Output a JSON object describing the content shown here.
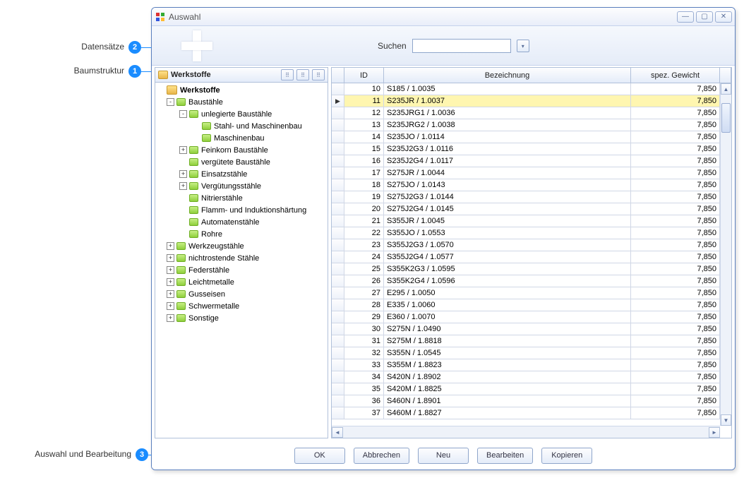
{
  "annotations": {
    "a1": {
      "label": "Baumstruktur",
      "num": "1"
    },
    "a2": {
      "label": "Datensätze",
      "num": "2"
    },
    "a3": {
      "label": "Auswahl und Bearbeitung",
      "num": "3"
    }
  },
  "window": {
    "title": "Auswahl"
  },
  "search": {
    "label": "Suchen",
    "value": ""
  },
  "tree": {
    "header": "Werkstoffe",
    "root": "Werkstoffe",
    "nodes": [
      {
        "indent": 1,
        "exp": "-",
        "icon": "green",
        "label": "Baustähle"
      },
      {
        "indent": 2,
        "exp": "-",
        "icon": "green",
        "label": "unlegierte Baustähle"
      },
      {
        "indent": 3,
        "exp": "",
        "icon": "green",
        "label": "Stahl- und Maschinenbau"
      },
      {
        "indent": 3,
        "exp": "",
        "icon": "green",
        "label": "Maschinenbau"
      },
      {
        "indent": 2,
        "exp": "+",
        "icon": "green",
        "label": "Feinkorn Baustähle"
      },
      {
        "indent": 2,
        "exp": "",
        "icon": "green",
        "label": "vergütete Baustähle"
      },
      {
        "indent": 2,
        "exp": "+",
        "icon": "green",
        "label": "Einsatzstähle"
      },
      {
        "indent": 2,
        "exp": "+",
        "icon": "green",
        "label": "Vergütungsstähle"
      },
      {
        "indent": 2,
        "exp": "",
        "icon": "green",
        "label": "Nitrierstähle"
      },
      {
        "indent": 2,
        "exp": "",
        "icon": "green",
        "label": "Flamm- und Induktionshärtung"
      },
      {
        "indent": 2,
        "exp": "",
        "icon": "green",
        "label": "Automatenstähle"
      },
      {
        "indent": 2,
        "exp": "",
        "icon": "green",
        "label": "Rohre"
      },
      {
        "indent": 1,
        "exp": "+",
        "icon": "green",
        "label": "Werkzeugstähle"
      },
      {
        "indent": 1,
        "exp": "+",
        "icon": "green",
        "label": "nichtrostende Stähle"
      },
      {
        "indent": 1,
        "exp": "+",
        "icon": "green",
        "label": "Federstähle"
      },
      {
        "indent": 1,
        "exp": "+",
        "icon": "green",
        "label": "Leichtmetalle"
      },
      {
        "indent": 1,
        "exp": "+",
        "icon": "green",
        "label": "Gusseisen"
      },
      {
        "indent": 1,
        "exp": "+",
        "icon": "green",
        "label": "Schwermetalle"
      },
      {
        "indent": 1,
        "exp": "+",
        "icon": "green",
        "label": "Sonstige"
      }
    ]
  },
  "table": {
    "columns": {
      "id": "ID",
      "bez": "Bezeichnung",
      "gew": "spez. Gewicht"
    },
    "selected_id": 11,
    "rows": [
      {
        "id": 10,
        "bez": "S185 / 1.0035",
        "gew": "7,850"
      },
      {
        "id": 11,
        "bez": "S235JR / 1.0037",
        "gew": "7,850"
      },
      {
        "id": 12,
        "bez": "S235JRG1 / 1.0036",
        "gew": "7,850"
      },
      {
        "id": 13,
        "bez": "S235JRG2 / 1.0038",
        "gew": "7,850"
      },
      {
        "id": 14,
        "bez": "S235JO / 1.0114",
        "gew": "7,850"
      },
      {
        "id": 15,
        "bez": "S235J2G3 / 1.0116",
        "gew": "7,850"
      },
      {
        "id": 16,
        "bez": "S235J2G4 / 1.0117",
        "gew": "7,850"
      },
      {
        "id": 17,
        "bez": "S275JR / 1.0044",
        "gew": "7,850"
      },
      {
        "id": 18,
        "bez": "S275JO / 1.0143",
        "gew": "7,850"
      },
      {
        "id": 19,
        "bez": "S275J2G3 / 1.0144",
        "gew": "7,850"
      },
      {
        "id": 20,
        "bez": "S275J2G4 / 1.0145",
        "gew": "7,850"
      },
      {
        "id": 21,
        "bez": "S355JR / 1.0045",
        "gew": "7,850"
      },
      {
        "id": 22,
        "bez": "S355JO / 1.0553",
        "gew": "7,850"
      },
      {
        "id": 23,
        "bez": "S355J2G3 / 1.0570",
        "gew": "7,850"
      },
      {
        "id": 24,
        "bez": "S355J2G4 / 1.0577",
        "gew": "7,850"
      },
      {
        "id": 25,
        "bez": "S355K2G3 / 1.0595",
        "gew": "7,850"
      },
      {
        "id": 26,
        "bez": "S355K2G4 / 1.0596",
        "gew": "7,850"
      },
      {
        "id": 27,
        "bez": "E295 / 1.0050",
        "gew": "7,850"
      },
      {
        "id": 28,
        "bez": "E335 / 1.0060",
        "gew": "7,850"
      },
      {
        "id": 29,
        "bez": "E360 / 1.0070",
        "gew": "7,850"
      },
      {
        "id": 30,
        "bez": "S275N / 1.0490",
        "gew": "7,850"
      },
      {
        "id": 31,
        "bez": "S275M / 1.8818",
        "gew": "7,850"
      },
      {
        "id": 32,
        "bez": "S355N / 1.0545",
        "gew": "7,850"
      },
      {
        "id": 33,
        "bez": "S355M / 1.8823",
        "gew": "7,850"
      },
      {
        "id": 34,
        "bez": "S420N / 1.8902",
        "gew": "7,850"
      },
      {
        "id": 35,
        "bez": "S420M / 1.8825",
        "gew": "7,850"
      },
      {
        "id": 36,
        "bez": "S460N / 1.8901",
        "gew": "7,850"
      },
      {
        "id": 37,
        "bez": "S460M / 1.8827",
        "gew": "7,850"
      }
    ]
  },
  "buttons": {
    "ok": "OK",
    "cancel": "Abbrechen",
    "new": "Neu",
    "edit": "Bearbeiten",
    "copy": "Kopieren"
  }
}
